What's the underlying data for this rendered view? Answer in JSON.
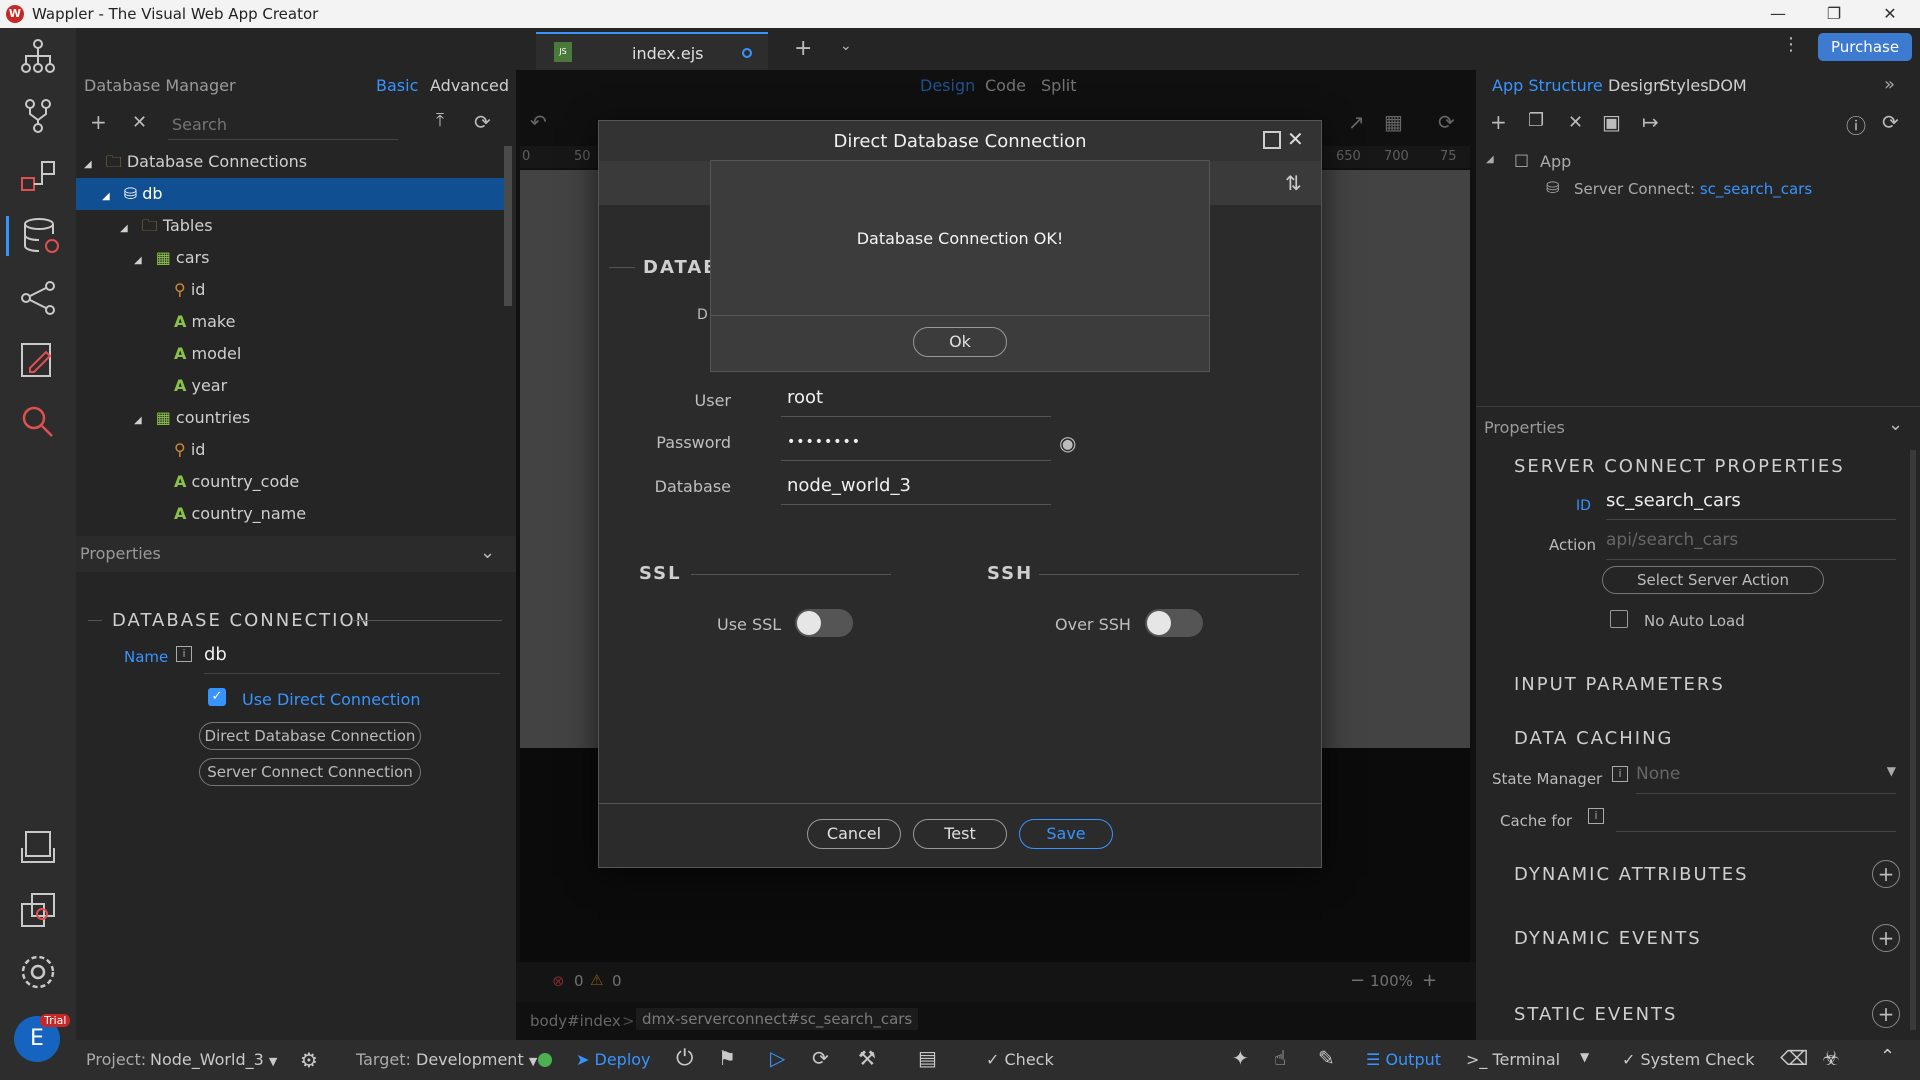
{
  "window": {
    "title": "Wappler - The Visual Web App Creator",
    "logo": "W"
  },
  "tab": {
    "file": "index.ejs",
    "badge": "JS"
  },
  "purchase_label": "Purchase",
  "left_panel": {
    "title": "Database Manager",
    "modes": [
      "Basic",
      "Advanced"
    ],
    "search_placeholder": "Search",
    "tree": [
      {
        "label": "Database Connections",
        "icon": "folder-icon",
        "indent": 0
      },
      {
        "label": "db",
        "icon": "database-icon",
        "indent": 1,
        "selected": true
      },
      {
        "label": "Tables",
        "icon": "folder-icon",
        "indent": 2
      },
      {
        "label": "cars",
        "icon": "table-icon",
        "indent": 3
      },
      {
        "label": "id",
        "icon": "key-icon",
        "indent": 4
      },
      {
        "label": "make",
        "icon": "text-icon",
        "indent": 4
      },
      {
        "label": "model",
        "icon": "text-icon",
        "indent": 4
      },
      {
        "label": "year",
        "icon": "text-icon",
        "indent": 4
      },
      {
        "label": "countries",
        "icon": "table-icon",
        "indent": 3
      },
      {
        "label": "id",
        "icon": "key-icon",
        "indent": 4
      },
      {
        "label": "country_code",
        "icon": "text-icon",
        "indent": 4
      },
      {
        "label": "country_name",
        "icon": "text-icon",
        "indent": 4
      }
    ],
    "properties_title": "Properties",
    "section": "DATABASE CONNECTION",
    "name_label": "Name",
    "name_value": "db",
    "use_direct_label": "Use Direct Connection",
    "btn_direct": "Direct Database Connection",
    "btn_server": "Server Connect Connection"
  },
  "center": {
    "views": [
      "Design",
      "Code",
      "Split"
    ],
    "ruler": [
      "0",
      "50",
      "650",
      "700",
      "75"
    ],
    "errors": "0",
    "warnings": "0",
    "zoom": "100%",
    "breadcrumb": [
      "body#index",
      "dmx-serverconnect#sc_search_cars"
    ]
  },
  "dialog": {
    "title": "Direct Database Connection",
    "section_db": "DATAB",
    "user_label": "User",
    "user_value": "root",
    "password_label": "Password",
    "password_value": "••••••••",
    "database_label": "Database",
    "database_value": "node_world_3",
    "ssl_title": "SSL",
    "ssh_title": "SSH",
    "use_ssl": "Use SSL",
    "over_ssh": "Over SSH",
    "cancel": "Cancel",
    "test": "Test",
    "save": "Save",
    "partial_label": "D"
  },
  "alert": {
    "message": "Database Connection OK!",
    "ok": "Ok"
  },
  "right_panel": {
    "tabs": [
      "App Structure",
      "Design",
      "Styles",
      "DOM"
    ],
    "tree_app": "App",
    "tree_sc_prefix": "Server Connect:",
    "tree_sc_name": "sc_search_cars",
    "properties_title": "Properties",
    "section": "SERVER CONNECT PROPERTIES",
    "id_label": "ID",
    "id_value": "sc_search_cars",
    "action_label": "Action",
    "action_placeholder": "api/search_cars",
    "select_action": "Select Server Action",
    "no_auto_load": "No Auto Load",
    "input_params": "INPUT PARAMETERS",
    "data_caching": "DATA CACHING",
    "state_manager_label": "State Manager",
    "state_manager_value": "None",
    "cache_for_label": "Cache for",
    "dyn_attrs": "DYNAMIC ATTRIBUTES",
    "dyn_events": "DYNAMIC EVENTS",
    "static_events": "STATIC EVENTS"
  },
  "statusbar": {
    "avatar": "E",
    "trial": "Trial",
    "project_label": "Project:",
    "project_value": "Node_World_3",
    "target_label": "Target:",
    "target_value": "Development",
    "deploy": "Deploy",
    "check": "Check",
    "output": "Output",
    "terminal": "Terminal",
    "system_check": "System Check"
  }
}
